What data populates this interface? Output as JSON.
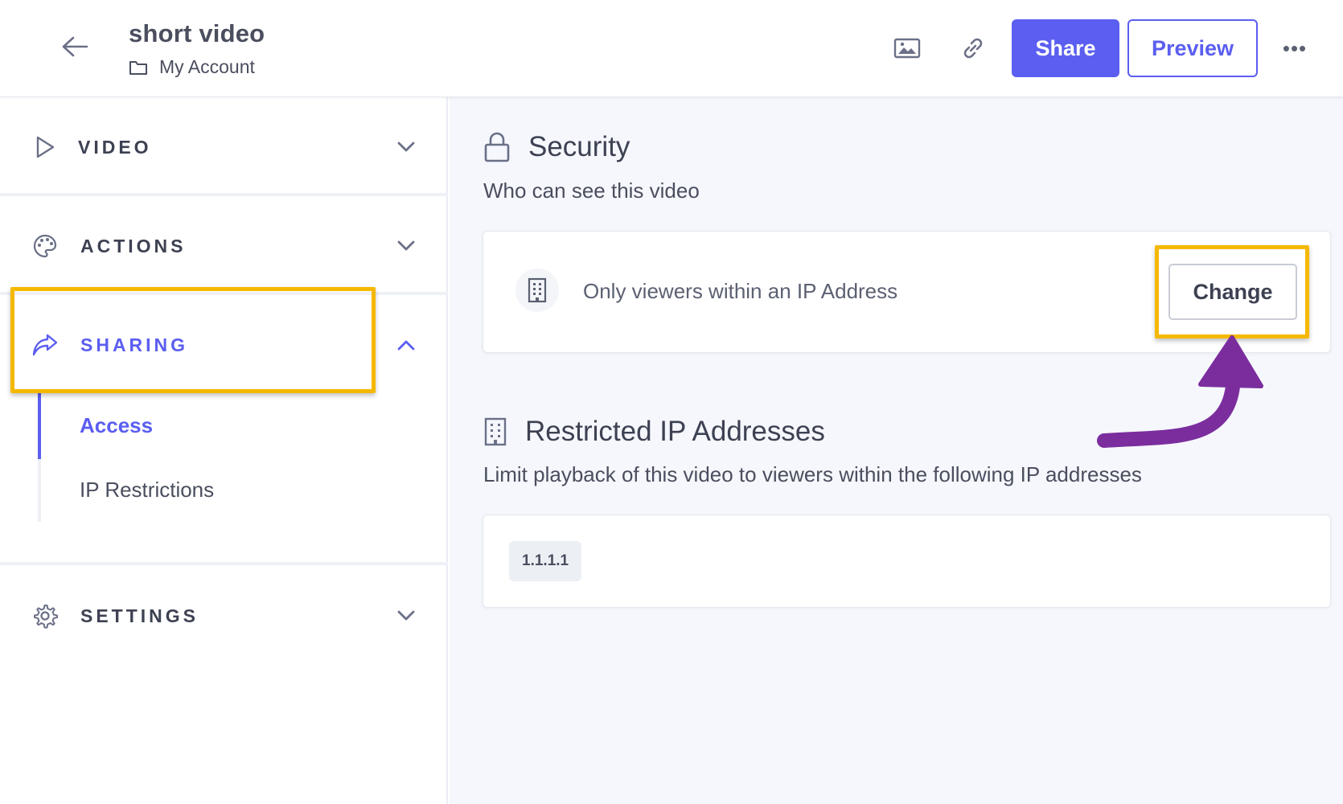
{
  "header": {
    "video_title": "short video",
    "account": "My Account",
    "share_label": "Share",
    "preview_label": "Preview",
    "more_label": "•••"
  },
  "sidebar": {
    "sections": [
      {
        "label": "VIDEO",
        "icon": "play-icon",
        "expanded": false
      },
      {
        "label": "ACTIONS",
        "icon": "palette-icon",
        "expanded": false
      },
      {
        "label": "SHARING",
        "icon": "share-arrow-icon",
        "expanded": true
      },
      {
        "label": "SETTINGS",
        "icon": "gear-icon",
        "expanded": false
      }
    ],
    "sharing_items": [
      {
        "label": "Access",
        "active": true
      },
      {
        "label": "IP Restrictions",
        "active": false
      }
    ]
  },
  "main": {
    "security": {
      "title": "Security",
      "description": "Who can see this video",
      "mode_text": "Only viewers within an IP Address",
      "change_label": "Change"
    },
    "restricted": {
      "title": "Restricted IP Addresses",
      "description": "Limit playback of this video to viewers within the following IP addresses",
      "ips": [
        "1.1.1.1"
      ]
    }
  },
  "colors": {
    "accent": "#5b5ef0",
    "highlight": "#f5b800",
    "annotation_arrow": "#7b2d9e"
  }
}
